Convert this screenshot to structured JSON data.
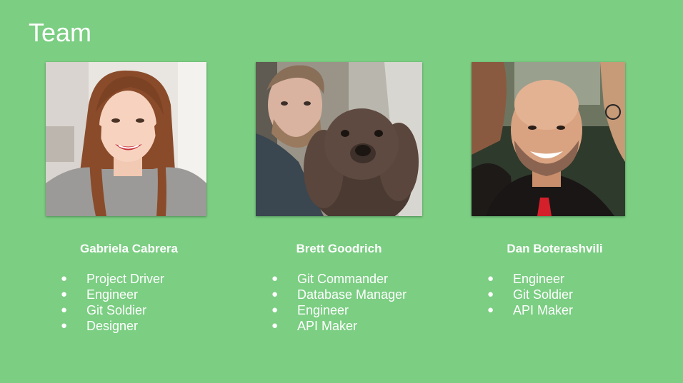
{
  "slide": {
    "title": "Team"
  },
  "members": [
    {
      "name": "Gabriela Cabrera",
      "photo_icon": "portrait-photo",
      "roles": [
        "Project Driver",
        "Engineer",
        "Git Soldier",
        "Designer"
      ]
    },
    {
      "name": "Brett Goodrich",
      "photo_icon": "portrait-with-dog-photo",
      "roles": [
        "Git Commander",
        "Database Manager",
        "Engineer",
        "API Maker"
      ]
    },
    {
      "name": "Dan Boterashvili",
      "photo_icon": "portrait-photo",
      "roles": [
        "Engineer",
        "Git Soldier",
        "API Maker"
      ]
    }
  ],
  "bullet_glyph": "●",
  "colors": {
    "background": "#7bce82",
    "text": "#ffffff"
  }
}
